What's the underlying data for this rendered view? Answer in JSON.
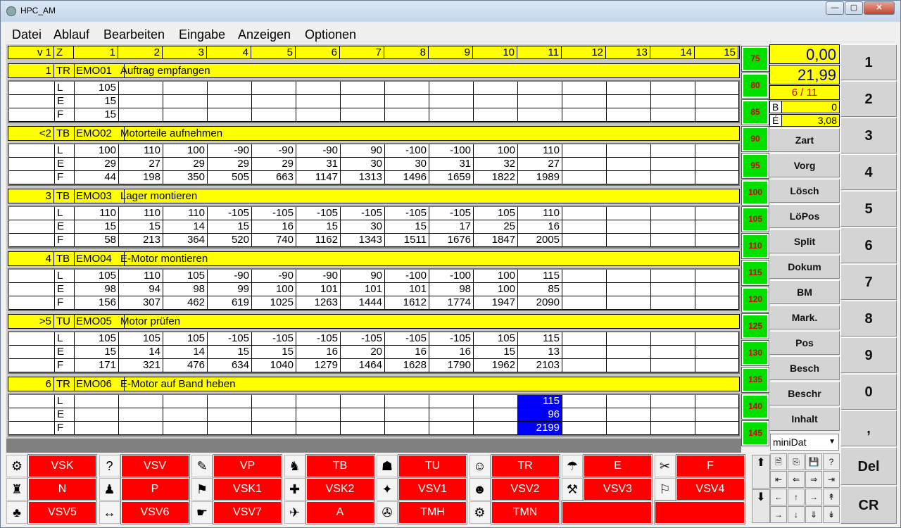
{
  "window": {
    "title": "HPC_AM",
    "min": "—",
    "max": "▢",
    "close": "✕"
  },
  "menu": [
    "Datei",
    "Ablauf",
    "Bearbeiten",
    "Eingabe",
    "Anzeigen",
    "Optionen"
  ],
  "header": {
    "v": "v 1",
    "z": "Z",
    "cols": [
      "1",
      "2",
      "3",
      "4",
      "5",
      "6",
      "7",
      "8",
      "9",
      "10",
      "11",
      "12",
      "13",
      "14",
      "15"
    ]
  },
  "ops": [
    {
      "num": "1",
      "type": "TR",
      "code": "EMO01",
      "desc": "Auftrag empfangen",
      "L": [
        "105",
        "",
        "",
        "",
        "",
        "",
        "",
        "",
        "",
        "",
        ""
      ],
      "E": [
        "15",
        "",
        "",
        "",
        "",
        "",
        "",
        "",
        "",
        "",
        ""
      ],
      "F": [
        "15",
        "",
        "",
        "",
        "",
        "",
        "",
        "",
        "",
        "",
        ""
      ]
    },
    {
      "num": "<2",
      "type": "TB",
      "code": "EMO02",
      "desc": "Motorteile aufnehmen",
      "L": [
        "100",
        "110",
        "100",
        "-90",
        "-90",
        "-90",
        "90",
        "-100",
        "-100",
        "100",
        "110"
      ],
      "E": [
        "29",
        "27",
        "29",
        "29",
        "29",
        "31",
        "30",
        "30",
        "31",
        "32",
        "27"
      ],
      "F": [
        "44",
        "198",
        "350",
        "505",
        "663",
        "1147",
        "1313",
        "1496",
        "1659",
        "1822",
        "1989"
      ]
    },
    {
      "num": "3",
      "type": "TB",
      "code": "EMO03",
      "desc": "Lager montieren",
      "L": [
        "110",
        "110",
        "110",
        "-105",
        "-105",
        "-105",
        "-105",
        "-105",
        "-105",
        "105",
        "110"
      ],
      "E": [
        "15",
        "15",
        "14",
        "15",
        "16",
        "15",
        "30",
        "15",
        "17",
        "25",
        "16"
      ],
      "F": [
        "58",
        "213",
        "364",
        "520",
        "740",
        "1162",
        "1343",
        "1511",
        "1676",
        "1847",
        "2005"
      ]
    },
    {
      "num": "4",
      "type": "TB",
      "code": "EMO04",
      "desc": "E-Motor montieren",
      "L": [
        "105",
        "110",
        "105",
        "-90",
        "-90",
        "-90",
        "90",
        "-100",
        "-100",
        "100",
        "115"
      ],
      "E": [
        "98",
        "94",
        "98",
        "99",
        "100",
        "101",
        "101",
        "101",
        "98",
        "100",
        "85"
      ],
      "F": [
        "156",
        "307",
        "462",
        "619",
        "1025",
        "1263",
        "1444",
        "1612",
        "1774",
        "1947",
        "2090"
      ]
    },
    {
      "num": ">5",
      "type": "TU",
      "code": "EMO05",
      "desc": "Motor prüfen",
      "L": [
        "105",
        "105",
        "105",
        "-105",
        "-105",
        "-105",
        "-105",
        "-105",
        "-105",
        "105",
        "115"
      ],
      "E": [
        "15",
        "14",
        "14",
        "15",
        "15",
        "16",
        "20",
        "16",
        "16",
        "15",
        "13"
      ],
      "F": [
        "171",
        "321",
        "476",
        "634",
        "1040",
        "1279",
        "1464",
        "1628",
        "1790",
        "1962",
        "2103"
      ]
    },
    {
      "num": "6",
      "type": "TR",
      "code": "EMO06",
      "desc": "E-Motor auf Band heben",
      "L": [
        "",
        "",
        "",
        "",
        "",
        "",
        "",
        "",
        "",
        "",
        "115"
      ],
      "E": [
        "",
        "",
        "",
        "",
        "",
        "",
        "",
        "",
        "",
        "",
        "96"
      ],
      "F": [
        "",
        "",
        "",
        "",
        "",
        "",
        "",
        "",
        "",
        "",
        "2199"
      ]
    }
  ],
  "rowlabels": [
    "L",
    "E",
    "F"
  ],
  "times": [
    "75",
    "80",
    "85",
    "90",
    "95",
    "100",
    "105",
    "110",
    "115",
    "120",
    "125",
    "130",
    "135",
    "140",
    "145"
  ],
  "display": {
    "v1": "0,00",
    "v2": "21,99",
    "ratio": "6 / 11",
    "b_label": "B",
    "b_val": "0",
    "e_label": "É",
    "e_val": "3,08"
  },
  "leftbuttons": [
    "Zart",
    "Vorg",
    "Lösch",
    "LöPos",
    "Split",
    "Dokum",
    "BM",
    "Mark.",
    "Pos",
    "Besch",
    "Beschr",
    "Inhalt"
  ],
  "combo": "miniDat",
  "numbuttons": [
    "1",
    "2",
    "3",
    "4",
    "5",
    "6",
    "7",
    "8",
    "9",
    "0",
    ",",
    "Del",
    "CR"
  ],
  "bottom": [
    [
      "VSK",
      "VSV",
      "VP",
      "TB",
      "TU",
      "TR",
      "E",
      "F"
    ],
    [
      "N",
      "P",
      "VSK1",
      "VSK2",
      "VSV1",
      "VSV2",
      "VSV3",
      "VSV4"
    ],
    [
      "VSV5",
      "VSV6",
      "VSV7",
      "A",
      "TMH",
      "TMN",
      "",
      ""
    ]
  ],
  "colors": {
    "highlight": "#0000ff",
    "yellow": "#ffff00",
    "red": "#ff0000",
    "green": "#00e000"
  }
}
